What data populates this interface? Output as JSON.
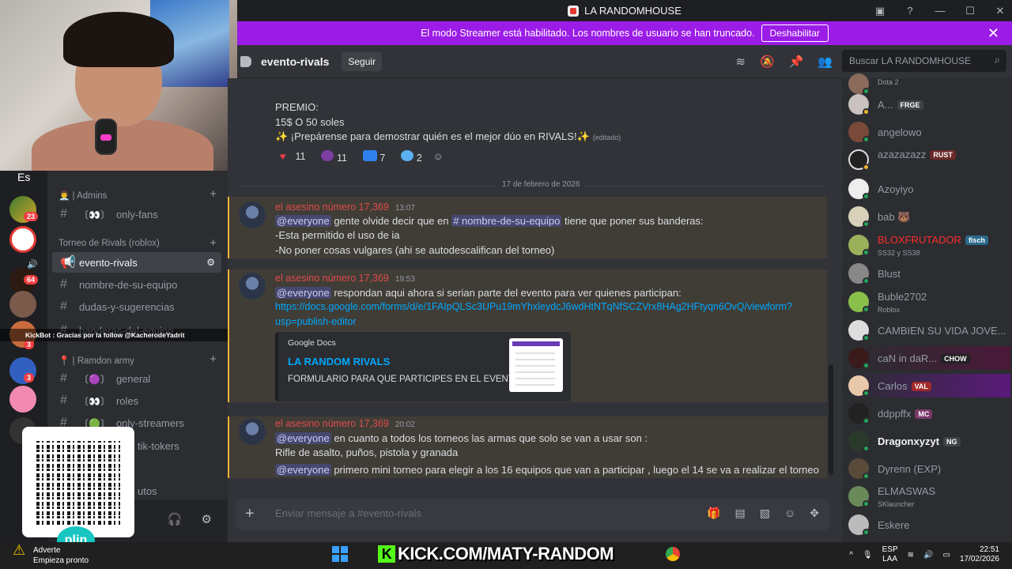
{
  "window": {
    "title": "LA RANDOMHOUSE"
  },
  "banner": {
    "text": "El modo Streamer está habilitado. Los nombres de usuario se han truncado.",
    "button": "Deshabilitar"
  },
  "header": {
    "channel": "evento-rivals",
    "follow": "Seguir",
    "search_placeholder": "Buscar LA RANDOMHOUSE"
  },
  "rail": {
    "lang": "Es",
    "badges": [
      "23",
      "64",
      "3",
      "3",
      "3"
    ]
  },
  "sidebar": {
    "cat_admins": "👨‍💼 | Admins",
    "cat_torneo": "Torneo de Rivals (roblox)",
    "cat_ramdon": "📍 | Ramdon army",
    "channels": [
      {
        "label": "only-fans",
        "prefix": "〔👀〕"
      },
      {
        "label": "evento-rivals"
      },
      {
        "label": "nombre-de-su-equipo"
      },
      {
        "label": "dudas-y-sugerencias"
      },
      {
        "label": "banderas-del-equipo"
      },
      {
        "label": "general",
        "prefix": "〔🟣〕"
      },
      {
        "label": "roles",
        "prefix": "〔👀〕"
      },
      {
        "label": "only-streamers",
        "prefix": "〔🟢〕"
      },
      {
        "label": "tik-tokers"
      },
      {
        "label": "utos"
      }
    ],
    "kickbot": "KickBot : Gracias por la follow @KacherodeYadrit"
  },
  "messages": {
    "prize": {
      "l1": "PREMIO:",
      "l2": "15$ O 50 soles",
      "l3": "✨ ¡Prepárense para demostrar quién es el mejor dúo en RIVALS!✨",
      "edited": "(editado)"
    },
    "reactions": [
      "11",
      "11",
      "7",
      "2"
    ],
    "date_divider": "17 de febrero de 2026",
    "m1": {
      "author": "el asesino número 17,369",
      "time": "13:07",
      "mention": "@everyone",
      "text_a": "gente olvide decir que en",
      "channel_mention": "# nombre-de-su-equipo",
      "text_b": "tiene  que poner sus banderas:",
      "l2": "-Esta permitido el uso de ia",
      "l3": "-No poner cosas vulgares (ahi se autodescalifican del torneo)"
    },
    "m2": {
      "author": "el asesino número 17,369",
      "time": "19:53",
      "mention": "@everyone",
      "text": "respondan aqui ahora si serian parte del evento para ver quienes participan:",
      "link1": "https://docs.google.com/forms/d/e/1FAIpQLSc3UPu19mYhxleydcJ6wdHtNTqNfSCZVrx8HAg2HFtyqn6OvQ/viewform?",
      "link2": "usp=publish-editor",
      "embed_provider": "Google Docs",
      "embed_title": "LA RANDOM RIVALS",
      "embed_desc": "FORMULARIO PARA QUE PARTICIPES EN EL EVENTO"
    },
    "m3": {
      "author": "el asesino número 17,369",
      "time": "20:02",
      "mention": "@everyone",
      "text": "en cuanto a todos los torneos las armas que solo se van a usar son :",
      "l2": "Rifle de asalto, puños, pistola y granada",
      "l3_mention": "@everyone",
      "l3": "primero mini torneo para elegir a los 16 equipos que van a participar , luego el 14 se va a realizar el torneo"
    }
  },
  "composer": {
    "placeholder": "Enviar mensaje a #evento-rivals"
  },
  "members": [
    {
      "name": "",
      "sub": "Dota 2"
    },
    {
      "name": "A...",
      "tag": "FRGE"
    },
    {
      "name": "angelowo"
    },
    {
      "name": "azazazazz",
      "tag": "RUST",
      "sub": ""
    },
    {
      "name": "Azoyiyo"
    },
    {
      "name": "bab 🐻"
    },
    {
      "name": "BLOXFRUTADOR",
      "tag": "fisch",
      "sub": "SS32 y SS38"
    },
    {
      "name": "Blust"
    },
    {
      "name": "Buble2702",
      "sub": "Roblox"
    },
    {
      "name": "CAMBIEN SU VIDA JOVE..."
    },
    {
      "name": "caN in daR...",
      "tag": "CHOW"
    },
    {
      "name": "Carlos",
      "tag": "VAL"
    },
    {
      "name": "ddppffx",
      "tag": "MC"
    },
    {
      "name": "Dragonxyzyt",
      "tag": "NG"
    },
    {
      "name": "Dyrenn (EXP)"
    },
    {
      "name": "ELMASWAS",
      "sub": "SKlauncher"
    },
    {
      "name": "Eskere"
    }
  ],
  "taskbar": {
    "warn_l1": "Adverte",
    "warn_l2": "Empieza pronto",
    "kick": "KICK.COM/MATY-RANDOM",
    "lang_l1": "ESP",
    "lang_l2": "LAA",
    "time": "22:51",
    "date": "17/02/2026"
  },
  "overlay": {
    "plin": "plin"
  },
  "colors": {
    "accent": "#9b1ce6",
    "mention_bg": "#3c4270",
    "link": "#00a8fc",
    "author": "#e04b4b",
    "online": "#23a55a",
    "kick": "#53fc18"
  }
}
